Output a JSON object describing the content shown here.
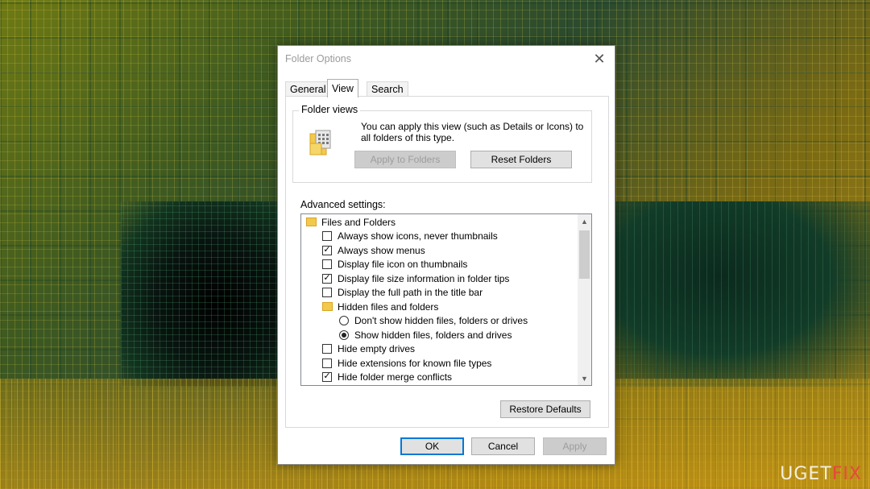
{
  "window": {
    "title": "Folder Options"
  },
  "tabs": [
    {
      "label": "General"
    },
    {
      "label": "View"
    },
    {
      "label": "Search"
    }
  ],
  "folder_views": {
    "group_label": "Folder views",
    "description": "You can apply this view (such as Details or Icons) to all folders of this type.",
    "apply_button": "Apply to Folders",
    "reset_button": "Reset Folders"
  },
  "advanced": {
    "label": "Advanced settings:",
    "items": [
      {
        "type": "folder",
        "label": "Files and Folders"
      },
      {
        "type": "checkbox",
        "label": "Always show icons, never thumbnails",
        "checked": false
      },
      {
        "type": "checkbox",
        "label": "Always show menus",
        "checked": true
      },
      {
        "type": "checkbox",
        "label": "Display file icon on thumbnails",
        "checked": false
      },
      {
        "type": "checkbox",
        "label": "Display file size information in folder tips",
        "checked": true
      },
      {
        "type": "checkbox",
        "label": "Display the full path in the title bar",
        "checked": false
      },
      {
        "type": "folder",
        "label": "Hidden files and folders"
      },
      {
        "type": "radio",
        "label": "Don't show hidden files, folders or drives",
        "checked": false
      },
      {
        "type": "radio",
        "label": "Show hidden files, folders and drives",
        "checked": true
      },
      {
        "type": "checkbox",
        "label": "Hide empty drives",
        "checked": false
      },
      {
        "type": "checkbox",
        "label": "Hide extensions for known file types",
        "checked": false
      },
      {
        "type": "checkbox",
        "label": "Hide folder merge conflicts",
        "checked": true
      }
    ],
    "restore_button": "Restore Defaults"
  },
  "footer": {
    "ok": "OK",
    "cancel": "Cancel",
    "apply": "Apply"
  },
  "watermark": {
    "prefix": "UG",
    "mid": "E",
    "t": "T",
    "fix": "FIX"
  },
  "colors": {
    "accent": "#0078d7",
    "folder": "#f2c94c",
    "watermark_fix": "#e64a3a"
  }
}
